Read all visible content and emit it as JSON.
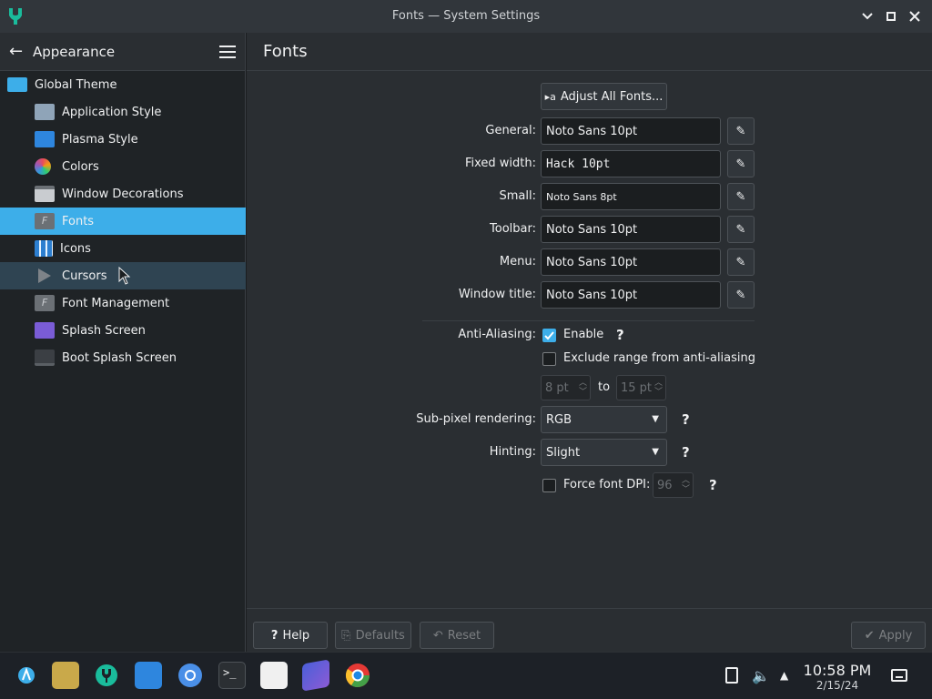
{
  "window": {
    "title": "Fonts — System Settings"
  },
  "sidebar": {
    "header": "Appearance",
    "items": [
      {
        "label": "Global Theme",
        "color": "#3daee9"
      },
      {
        "label": "Application Style",
        "color": "#8fa4b8"
      },
      {
        "label": "Plasma Style",
        "color": "#2e86de"
      },
      {
        "label": "Colors",
        "color": "#e84a5f"
      },
      {
        "label": "Window Decorations",
        "color": "#c9ccd0"
      },
      {
        "label": "Fonts",
        "color": "#6b7075"
      },
      {
        "label": "Icons",
        "color": "#2d7fd0"
      },
      {
        "label": "Cursors",
        "color": "#7e8388"
      },
      {
        "label": "Font Management",
        "color": "#6b7075"
      },
      {
        "label": "Splash Screen",
        "color": "#7a5cd6"
      },
      {
        "label": "Boot Splash Screen",
        "color": "#3b3f44"
      }
    ],
    "selected": "Fonts",
    "hovered": "Cursors"
  },
  "main": {
    "title": "Fonts",
    "adjust_all": "Adjust All Fonts...",
    "fonts": [
      {
        "label": "General:",
        "value": "Noto Sans 10pt"
      },
      {
        "label": "Fixed width:",
        "value": "Hack 10pt"
      },
      {
        "label": "Small:",
        "value": "Noto Sans 8pt"
      },
      {
        "label": "Toolbar:",
        "value": "Noto Sans 10pt"
      },
      {
        "label": "Menu:",
        "value": "Noto Sans 10pt"
      },
      {
        "label": "Window title:",
        "value": "Noto Sans 10pt"
      }
    ],
    "antialias_label": "Anti-Aliasing:",
    "antialias_enable": "Enable",
    "antialias_checked": true,
    "exclude_label": "Exclude range from anti-aliasing",
    "exclude_checked": false,
    "range_from": "8 pt",
    "range_to_label": "to",
    "range_to": "15 pt",
    "subpixel_label": "Sub-pixel rendering:",
    "subpixel_value": "RGB",
    "hinting_label": "Hinting:",
    "hinting_value": "Slight",
    "dpi_label": "Force font DPI:",
    "dpi_checked": false,
    "dpi_value": "96",
    "help_mark": "?"
  },
  "footer": {
    "help": "Help",
    "defaults": "Defaults",
    "reset": "Reset",
    "apply": "Apply"
  },
  "taskbar": {
    "time": "10:58 PM",
    "date": "2/15/24"
  }
}
